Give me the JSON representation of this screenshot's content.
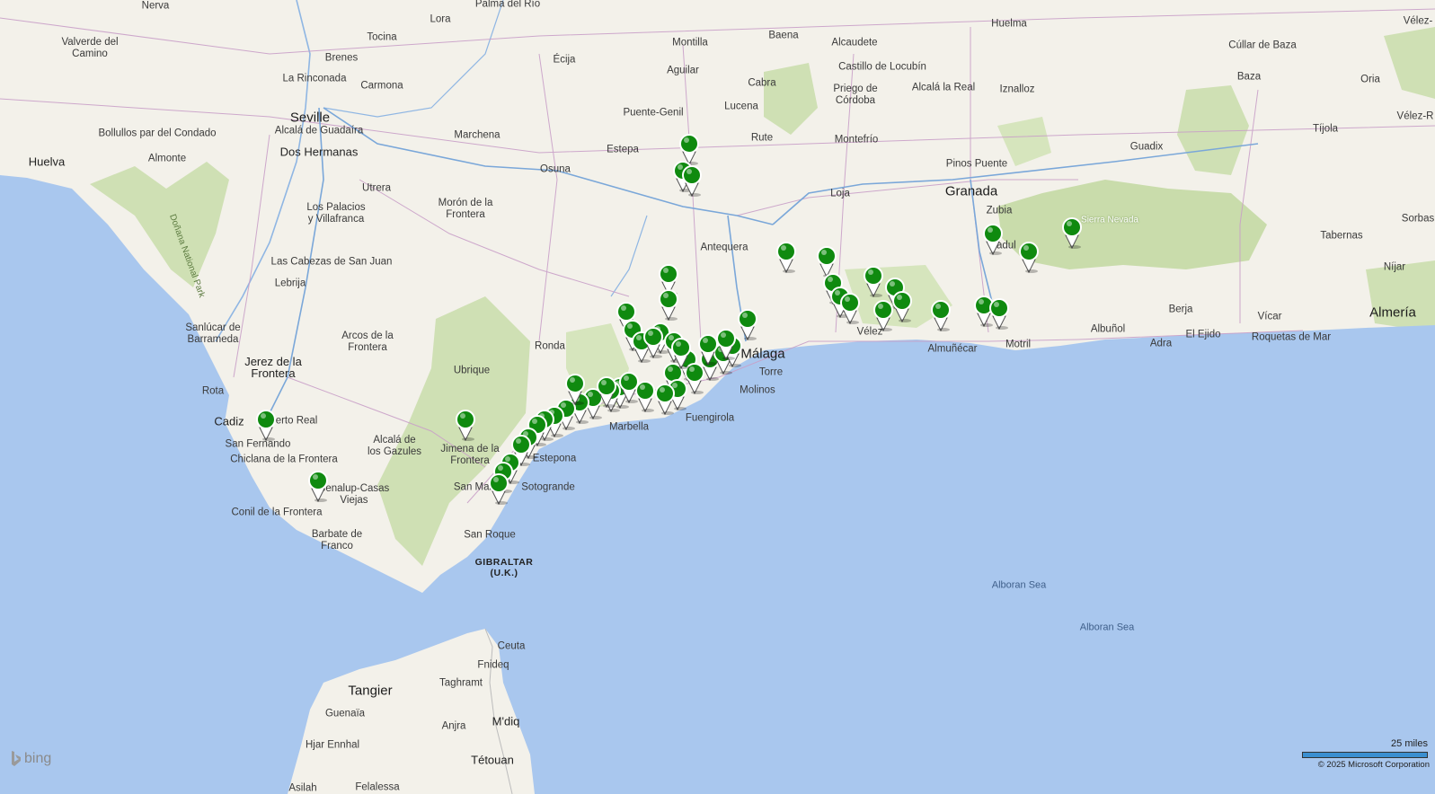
{
  "map": {
    "provider_logo": "bing",
    "scale_label": "25 miles",
    "copyright": "© 2025 Microsoft Corporation",
    "marker_color": "#0f8a0f",
    "sea_color": "#a9c7ee",
    "land_color": "#f3f1ea",
    "park_color": "#cfe0b4",
    "pin_icon": "map-pin-icon"
  },
  "labels": {
    "nerva": "Nerva",
    "lora": "Lora",
    "palma": "Palma del Río",
    "valverde": "Valverde del\nCamino",
    "tocina": "Tocina",
    "brenes": "Brenes",
    "rinconada": "La Rinconada",
    "carmona": "Carmona",
    "ecija": "Écija",
    "montilla": "Montilla",
    "aguilar": "Aguilar",
    "baena": "Baena",
    "alcaudete": "Alcaudete",
    "castillo": "Castillo de Locubín",
    "alcala_real": "Alcalá la Real",
    "huelma": "Huelma",
    "cullar": "Cúllar de Baza",
    "velez_blanco": "Vélez-",
    "seville": "Seville",
    "alcala_guadaira": "Alcalá de Guadaíra",
    "bollullos": "Bollullos par del Condado",
    "huelva": "Huelva",
    "almonte": "Almonte",
    "dos_hermanas": "Dos Hermanas",
    "marchena": "Marchena",
    "puente_genil": "Puente-Genil",
    "lucena": "Lucena",
    "cabra": "Cabra",
    "priego": "Priego de\nCórdoba",
    "iznalloz": "Iznalloz",
    "baza": "Baza",
    "oria": "Oria",
    "tijola": "Tíjola",
    "velez_rubio": "Vélez-R",
    "estepa": "Estepa",
    "osuna": "Osuna",
    "rute": "Rute",
    "montefrio": "Montefrío",
    "pinos_puente": "Pinos Puente",
    "guadix": "Guadix",
    "utrera": "Utrera",
    "moron": "Morón de la\nFrontera",
    "loja": "Loja",
    "granada": "Granada",
    "zubia": "Zubia",
    "sierra_nevada": "Sierra Nevada",
    "sorbas": "Sorbas",
    "los_palacios": "Los Palacios\ny Villafranca",
    "antequera": "Antequera",
    "padul": "Padul",
    "tabernas": "Tabernas",
    "cabezas": "Las Cabezas de San Juan",
    "nijar": "Níjar",
    "lebrija": "Lebrija",
    "donana": "Doñana National Park",
    "berja": "Berja",
    "vicar": "Vícar",
    "almeria": "Almería",
    "sanlucar": "Sanlúcar de\nBarrameda",
    "arcos": "Arcos de la\nFrontera",
    "ronda": "Ronda",
    "malaga": "Málaga",
    "velez": "Vélez",
    "almunecar": "Almuñécar",
    "motril": "Motril",
    "albunol": "Albuñol",
    "adra": "Adra",
    "el_ejido": "El Ejido",
    "roquetas": "Roquetas de Mar",
    "jerez": "Jerez de la\nFrontera",
    "ubrique": "Ubrique",
    "torre": "Torre",
    "molinos": "Molinos",
    "rota": "Rota",
    "cadiz": "Cadiz",
    "puerto_real": "Puerto Real",
    "marbella": "Marbella",
    "fuengirola": "Fuengirola",
    "san_fernando": "San Fernando",
    "alcala_gazules": "Alcalá de\nlos Gazules",
    "jimena": "Jimena de la\nFrontera",
    "chiclana": "Chiclana de la Frontera",
    "estepona": "Estepona",
    "benalup": "Benalup-Casas\nViejas",
    "san_martin": "San Martín",
    "sotogrande": "Sotogrande",
    "conil": "Conil de la Frontera",
    "barbate": "Barbate de\nFranco",
    "san_roque": "San Roque",
    "gibraltar": "GIBRALTAR\n(U.K.)",
    "alboran1": "Alboran Sea",
    "alboran2": "Alboran Sea",
    "ceuta": "Ceuta",
    "fnideq": "Fnideq",
    "tangier": "Tangier",
    "taghramt": "Taghramt",
    "guenaia": "Guenaïa",
    "anjra": "Anjra",
    "mdiq": "M'diq",
    "hjar": "Hjar Ennhal",
    "tetouan": "Tétouan",
    "asilah": "Asilah",
    "felalessa": "Felalessa"
  },
  "markers": [
    {
      "id": "m1",
      "count": 1
    },
    {
      "id": "m2",
      "count": 1
    },
    {
      "id": "m3",
      "count": 1
    },
    {
      "id": "m4",
      "count": 1
    },
    {
      "id": "m5",
      "count": 1
    },
    {
      "id": "m6",
      "count": 1
    },
    {
      "id": "m7",
      "count": 1
    },
    {
      "id": "m8",
      "count": 1
    }
  ]
}
